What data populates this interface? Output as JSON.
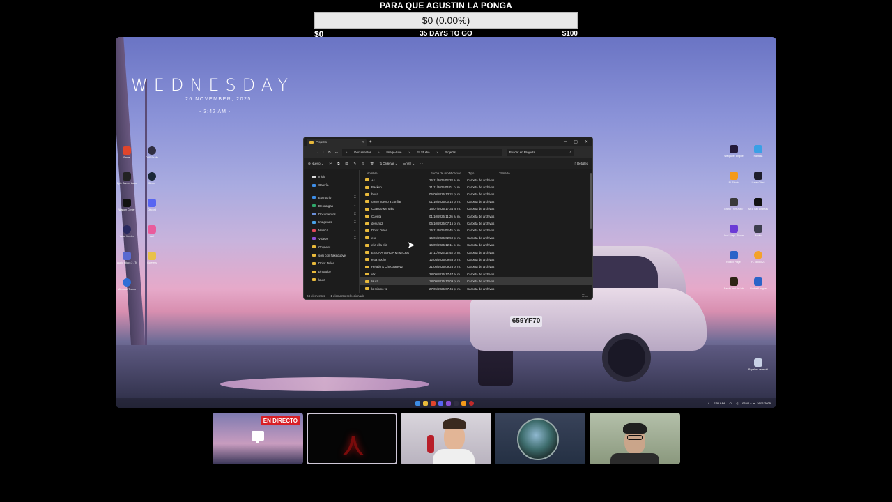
{
  "goal": {
    "title": "PARA QUE AGUSTIN LA PONGA",
    "progress_text": "$0 (0.00%)",
    "progress_fraction": 0,
    "min": "$0",
    "days": "35 DAYS TO GO",
    "max": "$100"
  },
  "wallpaper_clock": {
    "day": "WEDNESDAY",
    "date": "26 NOVEMBER, 2025.",
    "time": "- 3:42 AM -"
  },
  "wallpaper": {
    "plate": "659YF70"
  },
  "explorer": {
    "tab_title": "Projects",
    "new_tab": "+",
    "breadcrumbs": [
      "Documentos",
      "Image-Line",
      "FL Studio",
      "Projects"
    ],
    "search_placeholder": "Buscar en Projects",
    "commands": {
      "new": "Nuevo",
      "sort": "Ordenar",
      "view": "Ver",
      "more": "···",
      "details": "Detalles"
    },
    "nav_top": [
      "Inicio",
      "Galería"
    ],
    "nav_pinned": [
      "Escritorio",
      "Descargas",
      "Documentos",
      "Imágenes",
      "Música",
      "Vídeos",
      "Goyness",
      "solo con hakedubve",
      "Dolor Dulce",
      "pinpatico",
      "laura"
    ],
    "columns": [
      "Nombre",
      "Fecha de modificación",
      "Tipo",
      "Tamaño"
    ],
    "rows": [
      {
        "name": "+1",
        "date": "26/11/2025 03:28 a. m.",
        "type": "Carpeta de archivos"
      },
      {
        "name": "Backup",
        "date": "21/11/2025 04:01 p. m.",
        "type": "Carpeta de archivos"
      },
      {
        "name": "bruja",
        "date": "06/09/2025 13:21 p. m.",
        "type": "Carpeta de archivos"
      },
      {
        "name": "como vuelvo a confiar",
        "date": "01/10/2025 00:10 p. m.",
        "type": "Carpeta de archivos"
      },
      {
        "name": "Cuando Me Miro",
        "date": "16/07/2025 17:34 a. m.",
        "type": "Carpeta de archivos"
      },
      {
        "name": "Cuenta",
        "date": "01/10/2025 11:26 a. m.",
        "type": "Carpeta de archivos"
      },
      {
        "name": "desuris2",
        "date": "05/10/2025 07:15 p. m.",
        "type": "Carpeta de archivos"
      },
      {
        "name": "Dolor Dulce",
        "date": "16/11/2025 03:45 p. m.",
        "type": "Carpeta de archivos"
      },
      {
        "name": "eso",
        "date": "15/06/2025 02:59 p. m.",
        "type": "Carpeta de archivos"
      },
      {
        "name": "ella ella ella",
        "date": "16/09/2025 12:11 p. m.",
        "type": "Carpeta de archivos"
      },
      {
        "name": "ES UNA VERGA MI MICRO",
        "date": "17/11/2025 12:48 p. m.",
        "type": "Carpeta de archivos"
      },
      {
        "name": "esta noche",
        "date": "12/04/2025 09:58 p. m.",
        "type": "Carpeta de archivos"
      },
      {
        "name": "Helado & Chocolate v2",
        "date": "31/08/2025 09:25 p. m.",
        "type": "Carpeta de archivos"
      },
      {
        "name": "idk",
        "date": "28/09/2025 17:47 a. m.",
        "type": "Carpeta de archivos"
      },
      {
        "name": "laura",
        "date": "18/09/2025 12:09 p. m.",
        "type": "Carpeta de archivos"
      },
      {
        "name": "lo mismo v2",
        "date": "27/05/2025 07:45 p. m.",
        "type": "Carpeta de archivos"
      }
    ],
    "selected_index": 14,
    "status_count": "24 elementos",
    "status_selected": "1 elemento seleccionado"
  },
  "desktop_icons_left": [
    "Brave",
    "OBS Studio",
    "Epic Games Launcher",
    "Steam",
    "Wacom Center",
    "Discord",
    "Voice Meeter",
    "osu!",
    "Audio Hijack 2 - Tri-care Beta",
    "Goyness",
    "Microsoft Teams"
  ],
  "desktop_icons_right": [
    "Wallpaper Engine",
    "Pantalla",
    "FL Studio",
    "Lunar Client",
    "Grand Theft Auto V",
    "MTA San Andreas 1.6",
    "Ipv4 Ldap - Browse Plugins",
    "Andro",
    "Roblox Player",
    "FL Studio 21",
    "Bandy and the Ink Machine",
    "Rocket League",
    "Papelera de reciclaje"
  ],
  "taskbar": {
    "lang": "ESP LAA",
    "time": "03:42 a. m.",
    "date": "26/11/2025"
  },
  "stream": {
    "live_badge": "EN DIRECTO"
  }
}
